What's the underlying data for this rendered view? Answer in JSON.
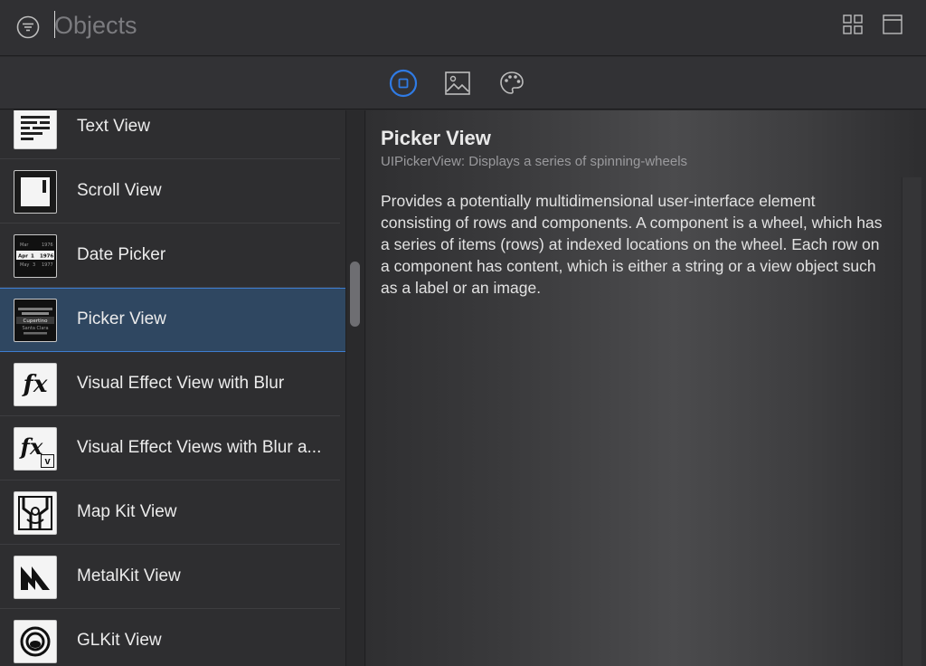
{
  "search": {
    "placeholder": "Objects",
    "value": ""
  },
  "header": {
    "icons": [
      "filter-icon",
      "grid-view-icon",
      "window-icon"
    ]
  },
  "tabs": [
    {
      "name": "objects",
      "icon": "square-in-circle-icon",
      "selected": true
    },
    {
      "name": "media",
      "icon": "image-icon",
      "selected": false
    },
    {
      "name": "colors",
      "icon": "palette-icon",
      "selected": false
    }
  ],
  "items": [
    {
      "label": "Text View",
      "icon": "text-view-icon"
    },
    {
      "label": "Scroll View",
      "icon": "scroll-view-icon"
    },
    {
      "label": "Date Picker",
      "icon": "date-picker-icon"
    },
    {
      "label": "Picker View",
      "icon": "picker-view-icon",
      "selected": true
    },
    {
      "label": "Visual Effect View with Blur",
      "icon": "fx-icon"
    },
    {
      "label": "Visual Effect Views with Blur a...",
      "icon": "fx-vibrancy-icon"
    },
    {
      "label": "Map Kit View",
      "icon": "map-icon"
    },
    {
      "label": "MetalKit View",
      "icon": "metal-icon"
    },
    {
      "label": "GLKit View",
      "icon": "glkit-icon"
    }
  ],
  "date_picker_thumb": [
    "Mar",
    "1976",
    "Apr",
    "1",
    "1976",
    "May",
    "3",
    "1977"
  ],
  "picker_thumb": [
    "Cupertino",
    "Santa Clara"
  ],
  "detail": {
    "title": "Picker View",
    "subtitle": "UIPickerView: Displays a series of spinning-wheels",
    "description": "Provides a potentially multidimensional user-interface element consisting of rows and components. A component is a wheel, which has a series of items (rows) at indexed locations on the wheel. Each row on a component has content, which is either a string or a view object such as a label or an image."
  },
  "colors": {
    "accent": "#3d7dd0",
    "selected_row": "#2f4761",
    "tab_selected": "#2f7be5"
  }
}
